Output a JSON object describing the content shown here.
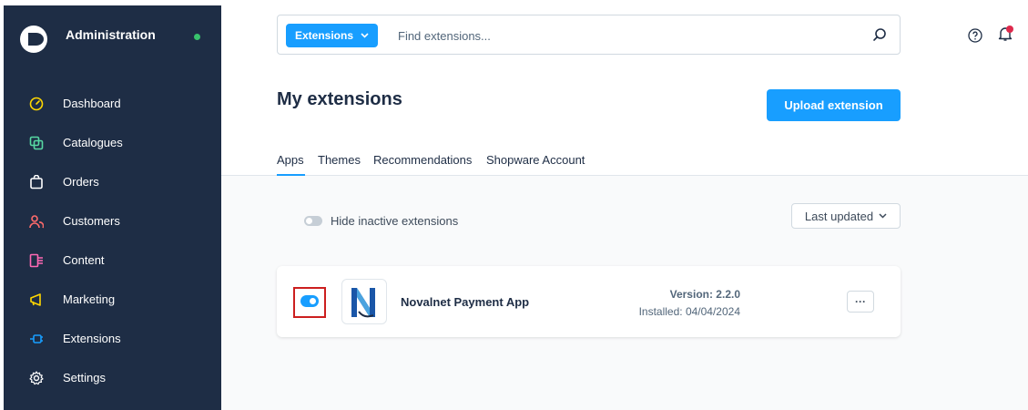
{
  "sidebar": {
    "title": "Administration",
    "items": [
      {
        "label": "Dashboard",
        "icon": "dashboard-icon"
      },
      {
        "label": "Catalogues",
        "icon": "catalogue-icon"
      },
      {
        "label": "Orders",
        "icon": "bag-icon"
      },
      {
        "label": "Customers",
        "icon": "users-icon"
      },
      {
        "label": "Content",
        "icon": "content-icon"
      },
      {
        "label": "Marketing",
        "icon": "megaphone-icon"
      },
      {
        "label": "Extensions",
        "icon": "plug-icon"
      },
      {
        "label": "Settings",
        "icon": "gear-icon"
      }
    ],
    "icon_colors": [
      "#ffd700",
      "#57d9a3",
      "#ffffff",
      "#ff6b6b",
      "#ff68b4",
      "#ffd700",
      "#189eff",
      "#ffffff"
    ]
  },
  "search": {
    "scope": "Extensions",
    "placeholder": "Find extensions..."
  },
  "page": {
    "title": "My extensions",
    "upload_label": "Upload extension",
    "tabs": [
      "Apps",
      "Themes",
      "Recommendations",
      "Shopware Account"
    ],
    "hide_inactive_label": "Hide inactive extensions",
    "sort_label": "Last updated"
  },
  "extension": {
    "name": "Novalnet Payment App",
    "version": "Version: 2.2.0",
    "installed": "Installed: 04/04/2024",
    "more": "···",
    "logo_letter": "N",
    "active": true
  },
  "colors": {
    "accent": "#189eff",
    "sidebar": "#1e2d45",
    "highlight": "#cc1f1f",
    "status_online": "#38c26c"
  }
}
